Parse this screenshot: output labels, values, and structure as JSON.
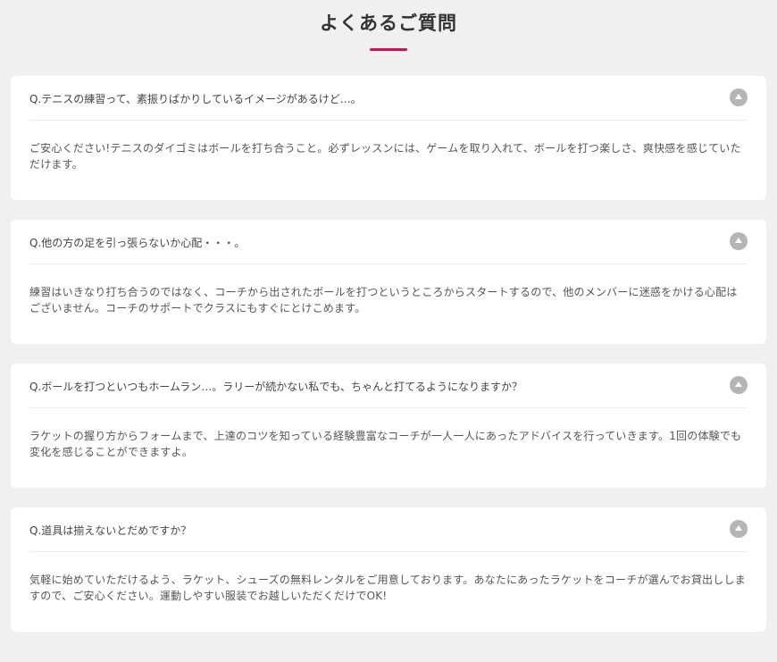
{
  "section": {
    "title": "よくあるご質問",
    "accent_color": "#d4114a"
  },
  "faq": [
    {
      "question": "Q.テニスの練習って、素振りばかりしているイメージがあるけど…。",
      "answer": "ご安心ください!テニスのダイゴミはボールを打ち合うこと。必ずレッスンには、ゲームを取り入れて、ボールを打つ楽しさ、爽快感を感じていただけます。",
      "icon": "chevron-up-icon"
    },
    {
      "question": "Q.他の方の足を引っ張らないか心配・・・。",
      "answer": "練習はいきなり打ち合うのではなく、コーチから出されたボールを打つというところからスタートするので、他のメンバーに迷惑をかける心配はございません。コーチのサポートでクラスにもすぐにとけこめます。",
      "icon": "chevron-up-icon"
    },
    {
      "question": "Q.ボールを打つといつもホームラン…。ラリーが続かない私でも、ちゃんと打てるようになりますか？",
      "answer": "ラケットの握り方からフォームまで、上達のコツを知っている経験豊富なコーチが一人一人にあったアドバイスを行っていきます。1回の体験でも変化を感じることができますよ。",
      "icon": "chevron-up-icon"
    },
    {
      "question": "Q.道具は揃えないとだめですか？",
      "answer": "気軽に始めていただけるよう、ラケット、シューズの無料レンタルをご用意しております。あなたにあったラケットをコーチが選んでお貸出ししますので、ご安心ください。運動しやすい服装でお越しいただくだけでOK!",
      "icon": "chevron-up-icon"
    }
  ]
}
